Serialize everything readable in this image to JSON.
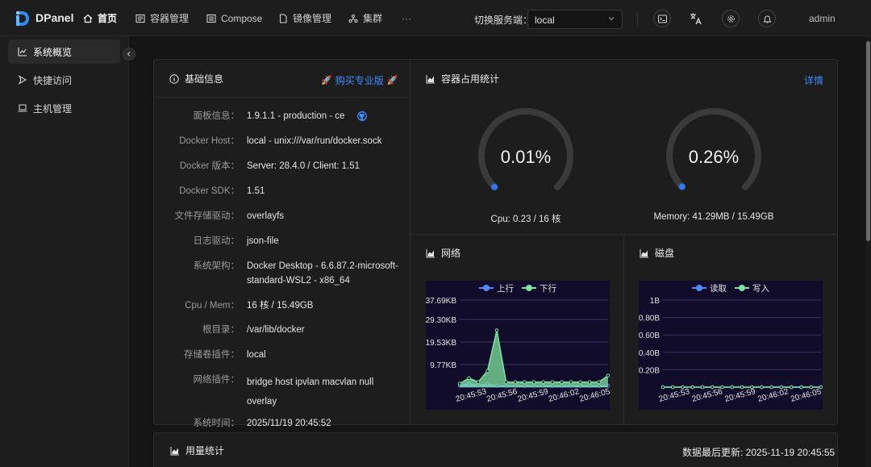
{
  "topbar": {
    "brand": "DPanel",
    "nav": [
      {
        "label": "首页",
        "icon": "home-icon",
        "active": true
      },
      {
        "label": "容器管理",
        "icon": "container-icon"
      },
      {
        "label": "Compose",
        "icon": "compose-icon"
      },
      {
        "label": "镜像管理",
        "icon": "file-icon"
      },
      {
        "label": "集群",
        "icon": "cluster-icon"
      }
    ],
    "more": "···",
    "server_label": "切换服务端：",
    "server_value": "local",
    "user": "admin"
  },
  "sidebar": {
    "items": [
      {
        "label": "系统概览",
        "icon": "chart-icon",
        "active": true
      },
      {
        "label": "快捷访问",
        "icon": "arrow-icon"
      },
      {
        "label": "主机管理",
        "icon": "laptop-icon"
      }
    ]
  },
  "info_panel": {
    "title": "基础信息",
    "promo": "购买专业版",
    "rows": [
      {
        "key": "面板信息：",
        "value": "1.9.1.1  -  production  -  ce"
      },
      {
        "key": "Docker Host：",
        "value": "local - unix:///var/run/docker.sock"
      },
      {
        "key": "Docker 版本：",
        "value": "Server: 28.4.0 / Client: 1.51"
      },
      {
        "key": "Docker SDK：",
        "value": "1.51"
      },
      {
        "key": "文件存储驱动：",
        "value": "overlayfs"
      },
      {
        "key": "日志驱动：",
        "value": "json-file"
      },
      {
        "key": "系统架构：",
        "value": "Docker Desktop - 6.6.87.2-microsoft-standard-WSL2 - x86_64"
      },
      {
        "key": "Cpu / Mem：",
        "value": "16 核 / 15.49GB"
      },
      {
        "key": "根目录：",
        "value": "/var/lib/docker"
      },
      {
        "key": "存储卷插件：",
        "value": "local"
      },
      {
        "key": "网络插件：",
        "value": "bridge  host  ipvlan  macvlan  null  overlay"
      },
      {
        "key": "系统时间：",
        "value": "2025/11/19 20:45:52"
      }
    ]
  },
  "usage_panel": {
    "title": "容器占用统计",
    "details": "详情",
    "cpu": {
      "percent": "0.01%",
      "fraction": 0.0001,
      "caption": "Cpu: 0.23 / 16 核"
    },
    "memory": {
      "percent": "0.26%",
      "fraction": 0.0026,
      "caption": "Memory: 41.29MB / 15.49GB"
    }
  },
  "network_panel": {
    "title": "网络"
  },
  "disk_panel": {
    "title": "磁盘"
  },
  "chart_data": [
    {
      "type": "area",
      "title": "网络",
      "legend": [
        "上行",
        "下行"
      ],
      "legend_position": "top",
      "colors": {
        "上行": "#4e8df7",
        "下行": "#7ee3a0"
      },
      "y_ticks": [
        "9.77KB",
        "19.53KB",
        "29.30KB",
        "37.69KB"
      ],
      "y_tick_values": [
        9.77,
        19.53,
        29.3,
        37.69
      ],
      "x_ticks": [
        "20:45:53",
        "20:45:56",
        "20:45:59",
        "20:46:02",
        "20:46:05"
      ],
      "ylim": [
        0,
        37.69
      ],
      "series": [
        {
          "name": "上行",
          "values": [
            0.6,
            1.6,
            0.8,
            1.4,
            0.5,
            0.5,
            0.5,
            0.5,
            0.5,
            0.5,
            0.5,
            0.5,
            0.5,
            0.5,
            0.5,
            0.5,
            0.6
          ]
        },
        {
          "name": "下行",
          "values": [
            1.5,
            3.9,
            2.2,
            7.0,
            24.6,
            2.2,
            2.2,
            2.2,
            2.2,
            2.2,
            2.2,
            2.2,
            2.2,
            2.2,
            2.2,
            2.2,
            5.0
          ]
        }
      ]
    },
    {
      "type": "line",
      "title": "磁盘",
      "legend": [
        "读取",
        "写入"
      ],
      "legend_position": "top",
      "colors": {
        "读取": "#4e8df7",
        "写入": "#7ee3a0"
      },
      "y_ticks": [
        "0.20B",
        "0.40B",
        "0.60B",
        "0.80B",
        "1B"
      ],
      "y_tick_values": [
        0.2,
        0.4,
        0.6,
        0.8,
        1.0
      ],
      "x_ticks": [
        "20:45:53",
        "20:45:56",
        "20:45:59",
        "20:46:02",
        "20:46:05"
      ],
      "ylim": [
        0,
        1
      ],
      "series": [
        {
          "name": "读取",
          "values": [
            0,
            0,
            0,
            0,
            0,
            0,
            0,
            0,
            0,
            0,
            0,
            0,
            0,
            0,
            0,
            0,
            0
          ]
        },
        {
          "name": "写入",
          "values": [
            0,
            0,
            0,
            0,
            0,
            0,
            0,
            0,
            0,
            0,
            0,
            0,
            0,
            0,
            0,
            0,
            0
          ]
        }
      ]
    }
  ],
  "bottom": {
    "title": "用量统计",
    "updated": "数据最后更新: 2025-11-19 20:45:55"
  }
}
